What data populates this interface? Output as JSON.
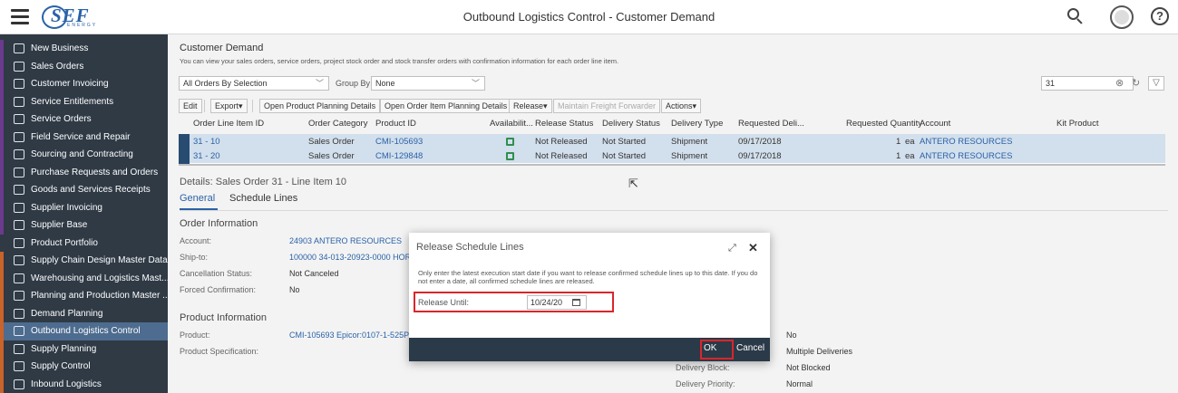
{
  "header": {
    "app_title": "Outbound Logistics Control - Customer Demand",
    "logo_text": "SEF",
    "logo_sub": "ENERGY"
  },
  "sidebar": {
    "items": [
      {
        "label": "New Business",
        "color": "#6b3a8f"
      },
      {
        "label": "Sales Orders",
        "color": "#6b3a8f"
      },
      {
        "label": "Customer Invoicing",
        "color": "#6b3a8f"
      },
      {
        "label": "Service Entitlements",
        "color": "#6b3a8f"
      },
      {
        "label": "Service Orders",
        "color": "#6b3a8f"
      },
      {
        "label": "Field Service and Repair",
        "color": "#6b3a8f"
      },
      {
        "label": "Sourcing and Contracting",
        "color": "#6b3a8f"
      },
      {
        "label": "Purchase Requests and Orders",
        "color": "#6b3a8f"
      },
      {
        "label": "Goods and Services Receipts",
        "color": "#6b3a8f"
      },
      {
        "label": "Supplier Invoicing",
        "color": "#6b3a8f"
      },
      {
        "label": "Supplier Base",
        "color": "#6b3a8f"
      },
      {
        "label": "Product Portfolio",
        "color": "#2f3a45"
      },
      {
        "label": "Supply Chain Design Master Data",
        "color": "#c8632a"
      },
      {
        "label": "Warehousing and Logistics Mast...",
        "color": "#c8632a"
      },
      {
        "label": "Planning and Production Master ...",
        "color": "#c8632a"
      },
      {
        "label": "Demand Planning",
        "color": "#c8632a"
      },
      {
        "label": "Outbound Logistics Control",
        "color": "#c8632a",
        "active": true
      },
      {
        "label": "Supply Planning",
        "color": "#c8632a"
      },
      {
        "label": "Supply Control",
        "color": "#c8632a"
      },
      {
        "label": "Inbound Logistics",
        "color": "#c8632a"
      }
    ]
  },
  "page": {
    "title": "Customer Demand",
    "subtitle": "You can view your sales orders, service orders, project stock order and stock transfer orders with confirmation information for each order line item.",
    "selection_value": "All Orders By Selection",
    "group_by_label": "Group By",
    "group_by_value": "None",
    "search_value": "31"
  },
  "toolbar": {
    "edit": "Edit",
    "export": "Export",
    "open_product_planning": "Open Product Planning Details",
    "open_order_item_planning": "Open Order Item Planning Details",
    "release": "Release",
    "maintain_freight": "Maintain Freight Forwarder",
    "actions": "Actions"
  },
  "table": {
    "columns": [
      "Order Line Item ID",
      "Order Category",
      "Product ID",
      "Availabilit...",
      "Release Status",
      "Delivery Status",
      "Delivery Type",
      "Requested Deli...",
      "Requested Quantity",
      "Account",
      "Kit Product"
    ],
    "rows": [
      {
        "id": "31 - 10",
        "category": "Sales Order",
        "product": "CMI-105693",
        "release": "Not Released",
        "delivery": "Not Started",
        "type": "Shipment",
        "date": "09/17/2018",
        "qty": "1",
        "unit": "ea",
        "account": "ANTERO RESOURCES"
      },
      {
        "id": "31 - 20",
        "category": "Sales Order",
        "product": "CMI-129848",
        "release": "Not Released",
        "delivery": "Not Started",
        "type": "Shipment",
        "date": "09/17/2018",
        "qty": "1",
        "unit": "ea",
        "account": "ANTERO RESOURCES"
      }
    ]
  },
  "details": {
    "title": "Details: Sales Order 31 - Line Item 10",
    "tab_general": "General",
    "tab_schedule": "Schedule Lines",
    "order_info_title": "Order Information",
    "account_label": "Account:",
    "account_value": "24903 ANTERO RESOURCES",
    "ship_to_label": "Ship-to:",
    "ship_to_value": "100000 34-013-20923-0000 HORS",
    "cancel_label": "Cancellation Status:",
    "cancel_value": "Not Canceled",
    "forced_label": "Forced Confirmation:",
    "forced_value": "No",
    "product_info_title": "Product Information",
    "product_label": "Product:",
    "product_value": "CMI-105693 Epicor:0107-1-525P1",
    "product_spec_label": "Product Specification:",
    "right_val_1": "No",
    "right_val_2": "Multiple Deliveries",
    "delivery_block_label": "Delivery Block:",
    "delivery_block_value": "Not Blocked",
    "delivery_priority_label": "Delivery Priority:",
    "delivery_priority_value": "Normal"
  },
  "dialog": {
    "title": "Release Schedule Lines",
    "note": "Only enter the latest execution start date if you want to release confirmed schedule lines up to this date. If you do not enter a date, all confirmed schedule lines are released.",
    "release_until_label": "Release Until:",
    "release_until_value": "10/24/20",
    "ok": "OK",
    "cancel": "Cancel"
  }
}
